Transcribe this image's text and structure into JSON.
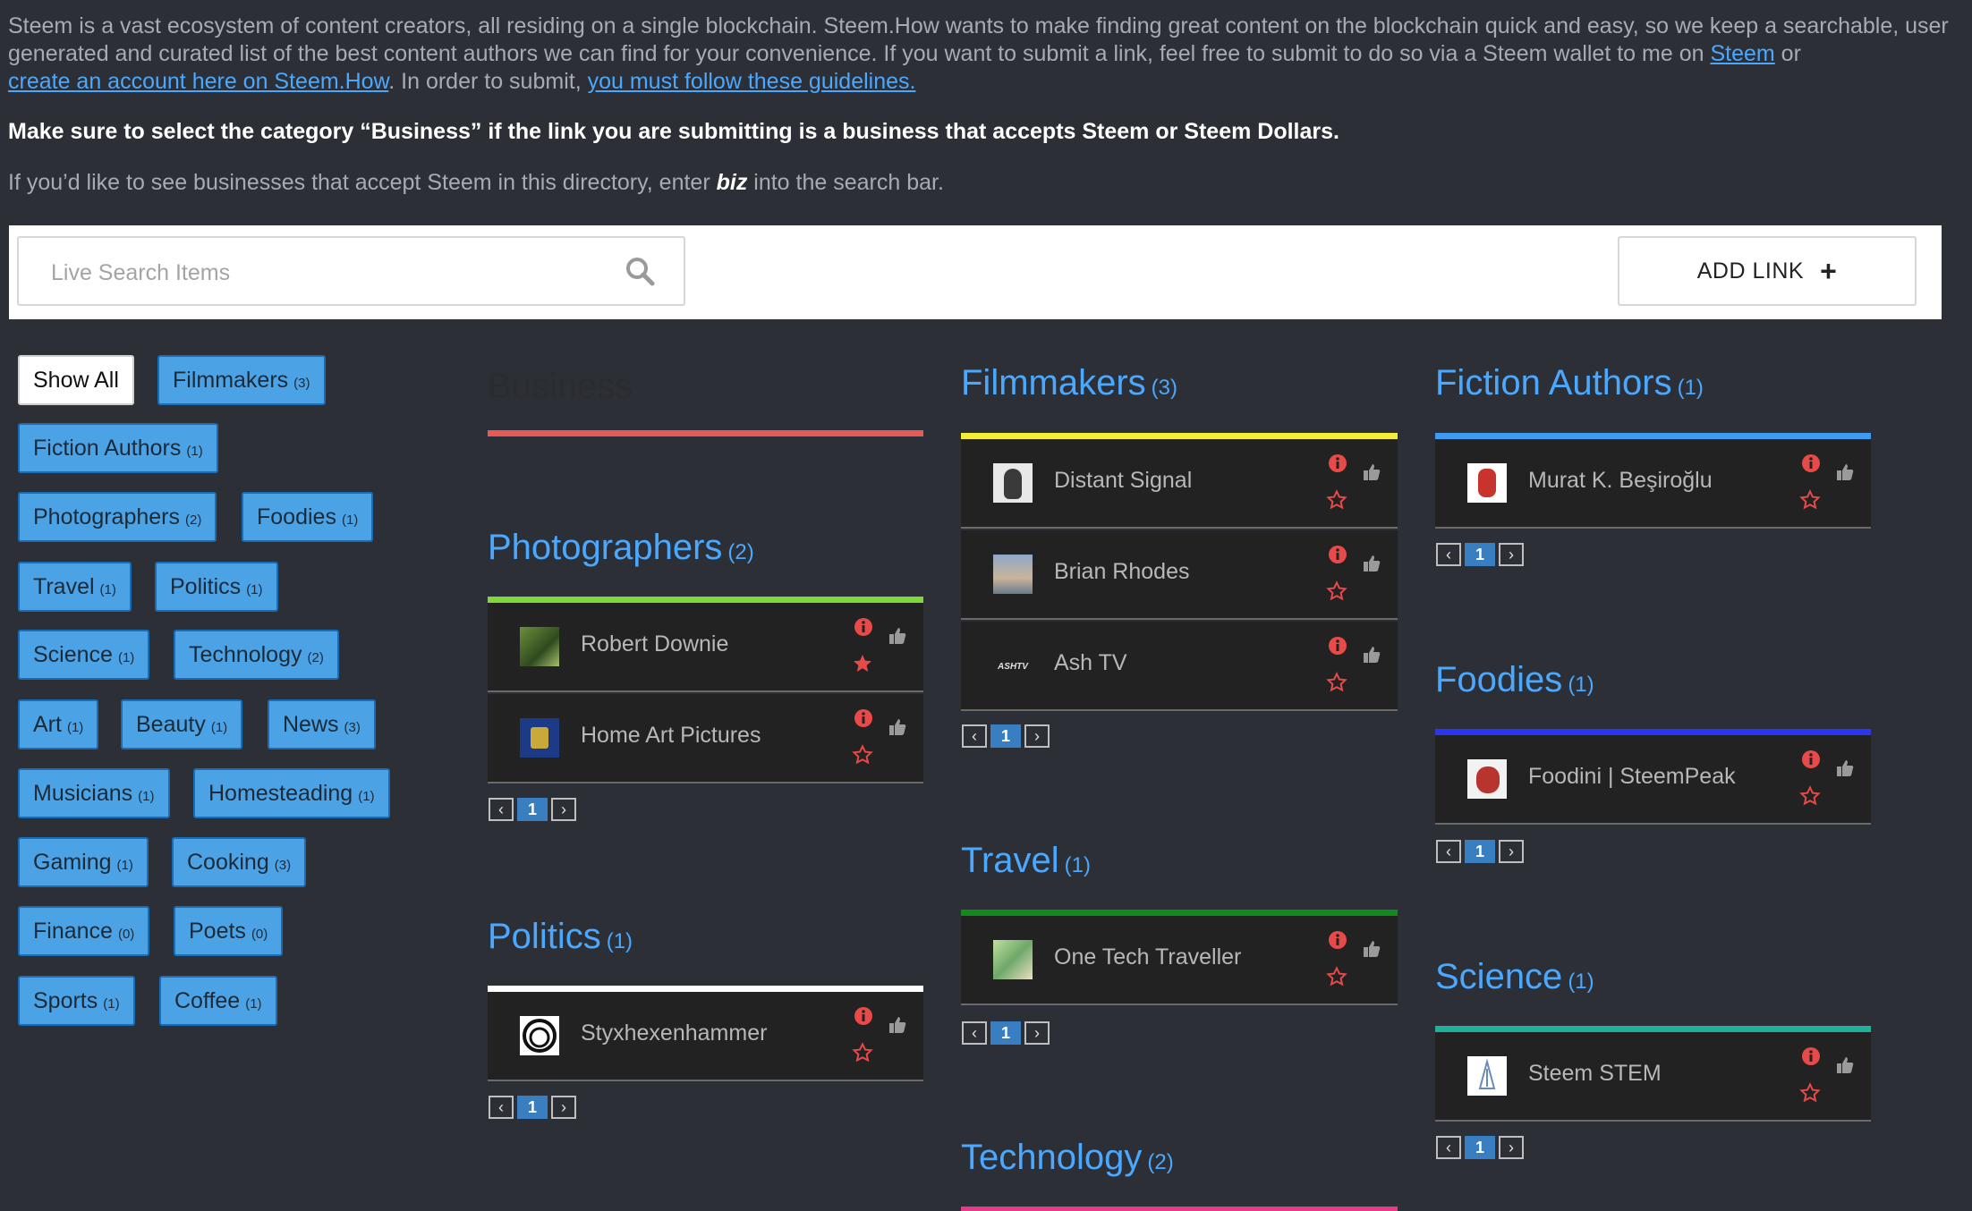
{
  "intro": {
    "p1_text": "Steem is a vast ecosystem of content creators, all residing on a single blockchain.  Steem.How wants to make finding great content on the blockchain quick and easy, so we keep a searchable, user generated and curated list of the best content authors we can find for your convenience.  If you want to  submit a link, feel free to submit to do so via a Steem wallet to me on ",
    "p1_link_steem": "Steem",
    "p1_or": " or",
    "p1_link_account": "create an account here on Steem.How",
    "p1_mid": ".  In order to submit, ",
    "p1_link_guidelines": "you must follow these guidelines.",
    "p2": "Make sure to select the category “Business” if the link you are submitting is a business that accepts Steem or Steem Dollars.",
    "p3_before": "If you’d like to see businesses that accept Steem in this directory, enter ",
    "p3_biz": "biz",
    "p3_after": " into the search bar."
  },
  "search": {
    "placeholder": "Live Search Items",
    "icon": "search-icon"
  },
  "add_link": {
    "label": "ADD LINK",
    "icon": "plus"
  },
  "filters": [
    {
      "label": "Show All",
      "count": ""
    },
    {
      "label": "Filmmakers",
      "count": "(3)"
    },
    {
      "label": "Fiction Authors",
      "count": "(1)"
    },
    {
      "label": "Photographers",
      "count": "(2)"
    },
    {
      "label": "Foodies",
      "count": "(1)"
    },
    {
      "label": "Travel",
      "count": "(1)"
    },
    {
      "label": "Politics",
      "count": "(1)"
    },
    {
      "label": "Science",
      "count": "(1)"
    },
    {
      "label": "Technology",
      "count": "(2)"
    },
    {
      "label": "Art",
      "count": "(1)"
    },
    {
      "label": "Beauty",
      "count": "(1)"
    },
    {
      "label": "News",
      "count": "(3)"
    },
    {
      "label": "Musicians",
      "count": "(1)"
    },
    {
      "label": "Homesteading",
      "count": "(1)"
    },
    {
      "label": "Gaming",
      "count": "(1)"
    },
    {
      "label": "Cooking",
      "count": "(3)"
    },
    {
      "label": "Finance",
      "count": "(0)"
    },
    {
      "label": "Poets",
      "count": "(0)"
    },
    {
      "label": "Sports",
      "count": "(1)"
    },
    {
      "label": "Coffee",
      "count": "(1)"
    }
  ],
  "categories": [
    {
      "title": "Filmmakers",
      "count": "(3)",
      "bar_color": "#f2ee3a",
      "page": "1",
      "items": [
        {
          "name": "Distant Signal",
          "starred": false
        },
        {
          "name": "Brian Rhodes",
          "starred": false
        },
        {
          "name": "Ash TV",
          "starred": false
        }
      ]
    },
    {
      "title": "Fiction Authors",
      "count": "(1)",
      "bar_color": "#3f9bf0",
      "page": "1",
      "items": [
        {
          "name": "Murat K. Beşiroğlu",
          "starred": false
        }
      ]
    },
    {
      "title": "Photographers",
      "count": "(2)",
      "bar_color": "#7ed83b",
      "page": "1",
      "items": [
        {
          "name": "Robert Downie",
          "starred": true
        },
        {
          "name": "Home Art Pictures",
          "starred": false
        }
      ]
    },
    {
      "title": "Foodies",
      "count": "(1)",
      "bar_color": "#2b36f2",
      "page": "1",
      "items": [
        {
          "name": "Foodini | SteemPeak",
          "starred": false
        }
      ]
    },
    {
      "title": "Travel",
      "count": "(1)",
      "bar_color": "#108a1c",
      "page": "1",
      "items": [
        {
          "name": "One Tech Traveller",
          "starred": false
        }
      ]
    },
    {
      "title": "Politics",
      "count": "(1)",
      "bar_color": "#ffffff",
      "page": "1",
      "items": [
        {
          "name": "Styxhexenhammer",
          "starred": false
        }
      ]
    },
    {
      "title": "Science",
      "count": "(1)",
      "bar_color": "#1fb29a",
      "page": "1",
      "items": [
        {
          "name": "Steem STEM",
          "starred": false
        }
      ]
    },
    {
      "title": "Technology",
      "count": "(2)",
      "bar_color": "#e83a8a",
      "page": "",
      "items": []
    }
  ],
  "hidden_category": {
    "title": "Business",
    "bar_color": "#e85a55"
  },
  "colors": {
    "accent": "#4aa8ff",
    "background": "#2d2f36",
    "icon_red": "#e84a4a"
  }
}
